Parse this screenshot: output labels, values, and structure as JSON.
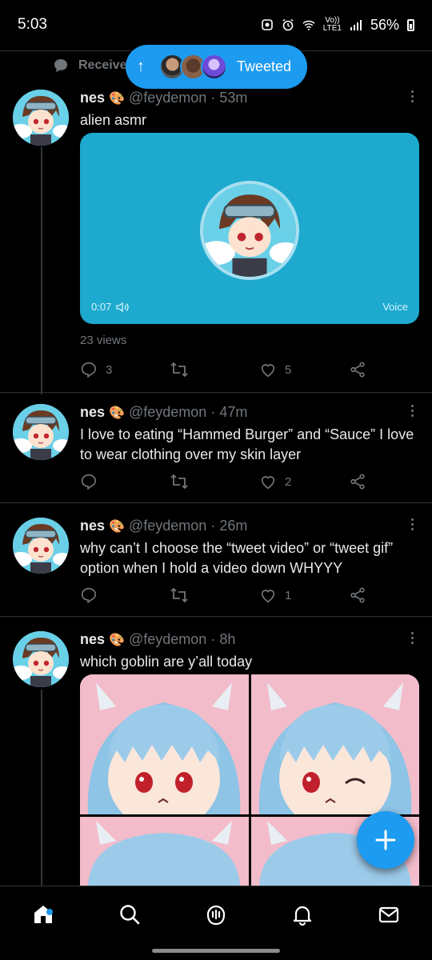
{
  "status_bar": {
    "time": "5:03",
    "lte_top": "Vo))",
    "lte_bottom": "LTE1",
    "battery": "56%"
  },
  "banner": {
    "received_label": "Receive",
    "tweeted_label": "Tweeted"
  },
  "tweets": [
    {
      "name": "nes",
      "emoji": "🎨",
      "handle": "@feydemon",
      "time": "53m",
      "text": "alien asmr",
      "voice": {
        "duration": "0:07",
        "label": "Voice"
      },
      "views": "23 views",
      "replies": "3",
      "retweets": "",
      "likes": "5"
    },
    {
      "name": "nes",
      "emoji": "🎨",
      "handle": "@feydemon",
      "time": "47m",
      "text": "I love to eating “Hammed Burger” and “Sauce” I love to wear clothing over my skin layer",
      "replies": "",
      "retweets": "",
      "likes": "2"
    },
    {
      "name": "nes",
      "emoji": "🎨",
      "handle": "@feydemon",
      "time": "26m",
      "text": "why can’t I choose the “tweet video” or “tweet gif” option when I hold a video down WHYYY",
      "replies": "",
      "retweets": "",
      "likes": "1"
    },
    {
      "name": "nes",
      "emoji": "🎨",
      "handle": "@feydemon",
      "time": "8h",
      "text": "which goblin are y’all today"
    }
  ],
  "colors": {
    "accent": "#1d9bf0",
    "voice_card": "#1ea9cf",
    "background": "#000000"
  }
}
